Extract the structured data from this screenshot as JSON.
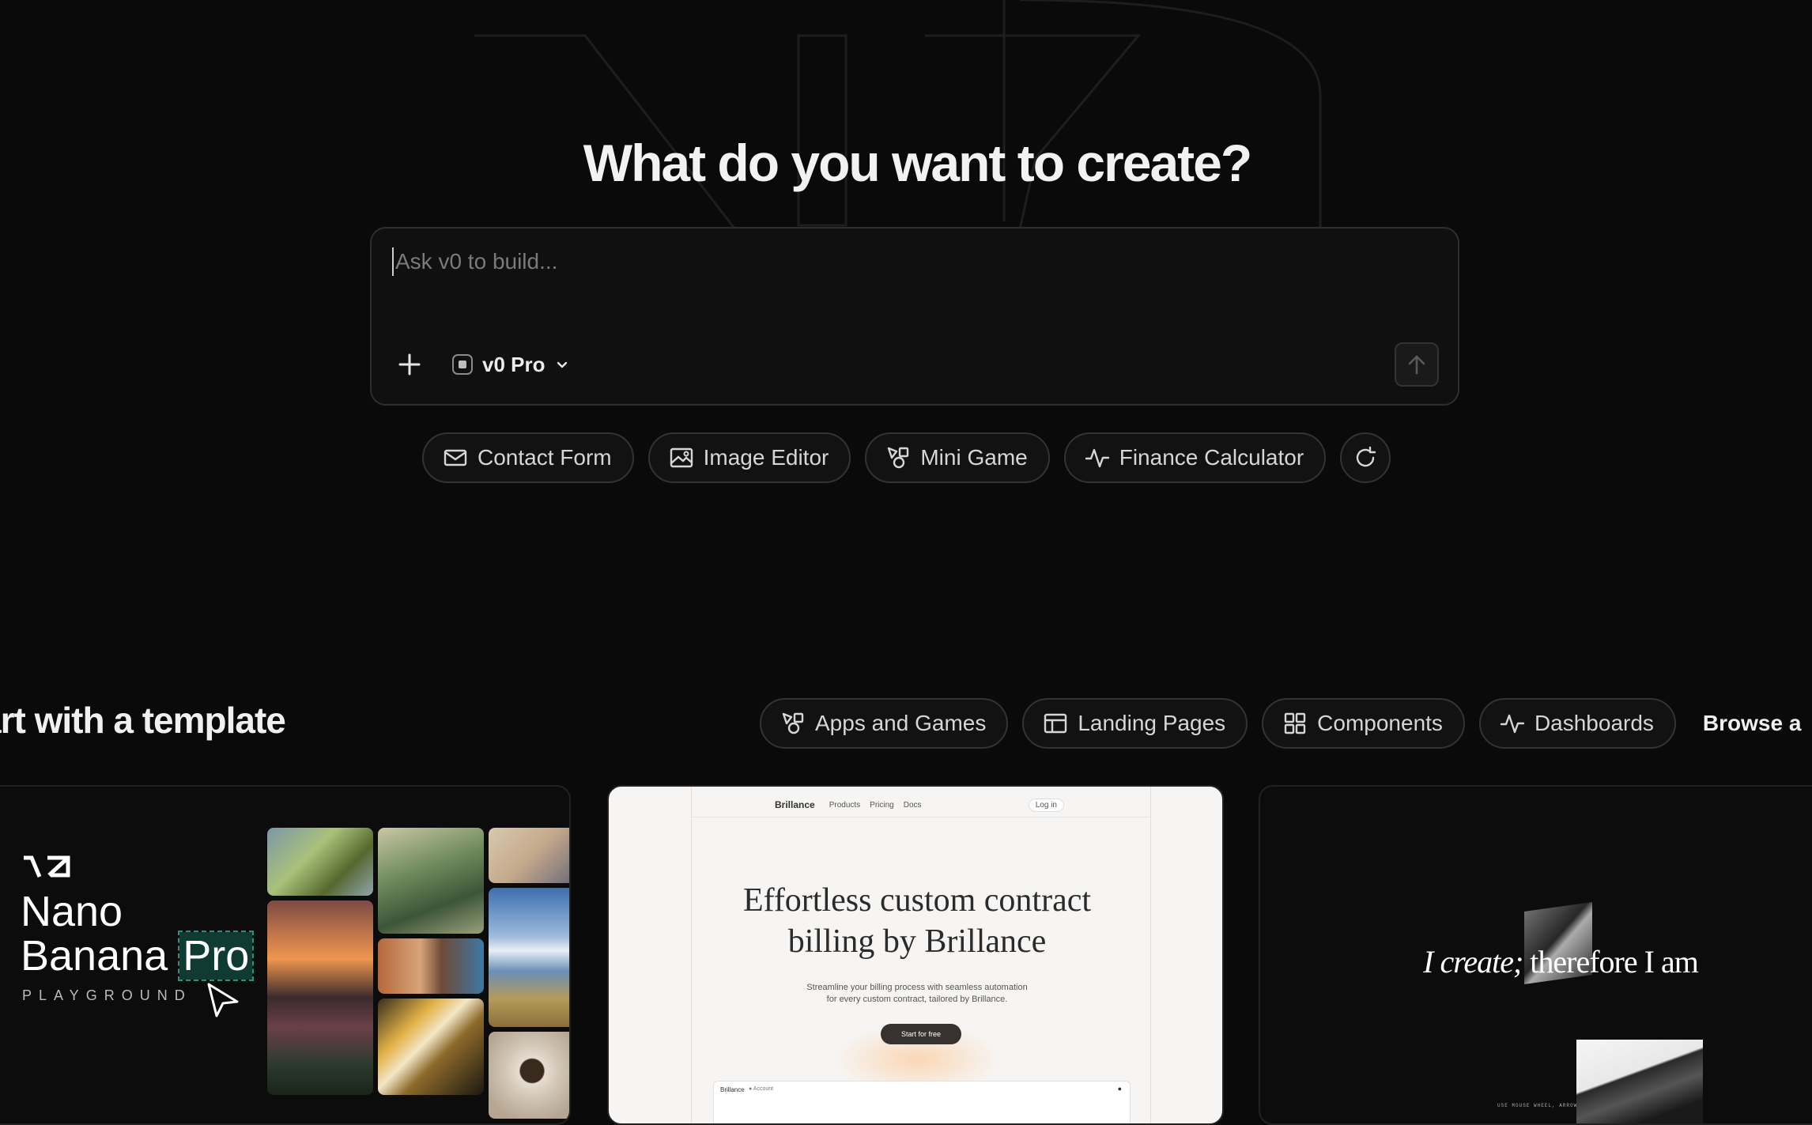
{
  "hero": {
    "title": "What do you want to create?"
  },
  "prompt": {
    "placeholder": "Ask v0 to build...",
    "model": "v0 Pro"
  },
  "suggestions": [
    {
      "label": "Contact Form",
      "icon": "mail-icon"
    },
    {
      "label": "Image Editor",
      "icon": "image-icon"
    },
    {
      "label": "Mini Game",
      "icon": "shapes-icon"
    },
    {
      "label": "Finance Calculator",
      "icon": "activity-icon"
    }
  ],
  "templates": {
    "title": "Start with a template",
    "visible_title": "art with a template",
    "filters": [
      {
        "label": "Apps and Games",
        "icon": "shapes-icon"
      },
      {
        "label": "Landing Pages",
        "icon": "layout-icon"
      },
      {
        "label": "Components",
        "icon": "grid-icon"
      },
      {
        "label": "Dashboards",
        "icon": "activity-icon"
      }
    ],
    "browse": "Browse a"
  },
  "cards": {
    "nano": {
      "logo": "v0",
      "line1": "Nano",
      "line2": "Banana",
      "highlight": "Pro",
      "sub": "PLAYGROUND"
    },
    "brillance": {
      "brand": "Brillance",
      "nav": [
        "Products",
        "Pricing",
        "Docs"
      ],
      "login": "Log in",
      "headline1": "Effortless custom contract",
      "headline2": "billing by Brillance",
      "desc1": "Streamline your billing process with seamless automation",
      "desc2": "for every custom contract, tailored by Brillance.",
      "cta": "Start for free",
      "footer_brand": "Brillance",
      "footer_account": "Account"
    },
    "create": {
      "text_italic": "I create;",
      "text_rest": "therefore I am",
      "hint": "USE MOUSE WHEEL, ARROW KEYS, OR TOUCH TO NAVIGATE"
    }
  },
  "colors": {
    "background": "#0a0a0a",
    "border": "#333333",
    "text": "#ededed",
    "accent_green": "#0f3b33"
  }
}
